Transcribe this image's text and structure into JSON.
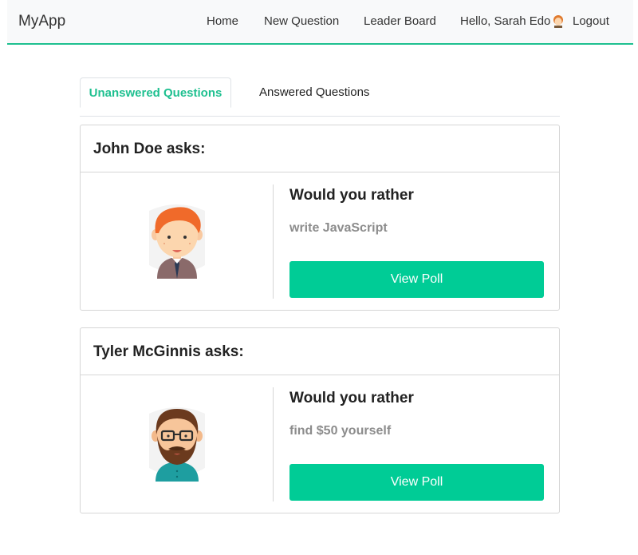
{
  "navbar": {
    "brand": "MyApp",
    "links": {
      "home": "Home",
      "new_question": "New Question",
      "leader_board": "Leader Board",
      "greeting": "Hello, Sarah Edo",
      "logout": "Logout"
    },
    "user_avatar_icon": "user-avatar-icon"
  },
  "tabs": {
    "unanswered": "Unanswered Questions",
    "answered": "Answered Questions",
    "active": "unanswered"
  },
  "colors": {
    "accent": "#1fc090",
    "button": "#00cc96"
  },
  "questions": [
    {
      "author_heading": "John Doe asks:",
      "title": "Would you rather",
      "option_preview": "write JavaScript",
      "button_label": "View Poll",
      "avatar_icon": "red-hair-man-avatar-icon"
    },
    {
      "author_heading": "Tyler McGinnis asks:",
      "title": "Would you rather",
      "option_preview": "find $50 yourself",
      "button_label": "View Poll",
      "avatar_icon": "bearded-man-glasses-avatar-icon"
    }
  ]
}
